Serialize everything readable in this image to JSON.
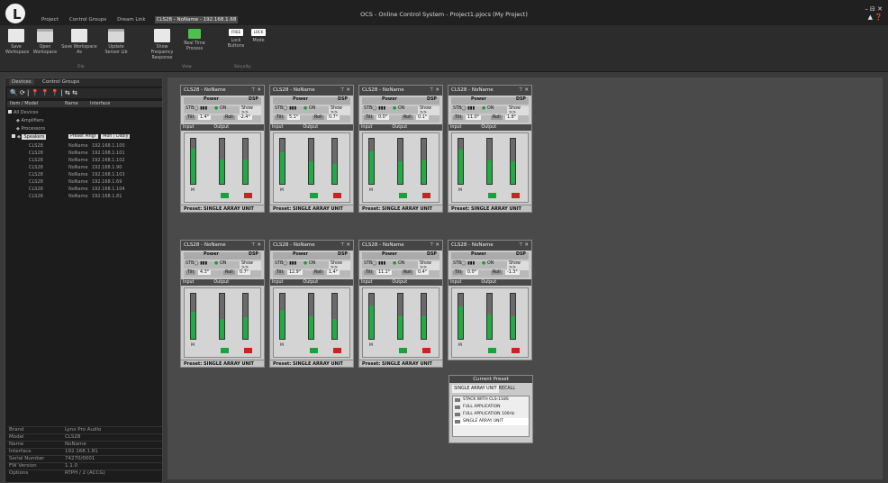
{
  "app": {
    "title": "OCS - Online Control System - Project1.pjocs (My Project)",
    "window_controls": "– ⊟ ✕",
    "help": "▲ ❓"
  },
  "menu_tabs": [
    "Project",
    "Control Groups",
    "Dream Link",
    "CLS28 - NoName - 192.168.1.68"
  ],
  "ribbon": {
    "buttons": [
      "Save Workspace",
      "Open Workspace",
      "Save Workspace As",
      "Update Sensor Lib",
      "Show Frequency Response",
      "Real Time Process",
      "Lock Buttons",
      "Mode"
    ],
    "groups": [
      "File",
      "View",
      "Security"
    ],
    "small_labels": [
      "FREE",
      "LOCK"
    ]
  },
  "left_panel": {
    "tabs": [
      "Devices",
      "Control Groups"
    ],
    "toolbar": "🔍 ⟳ | 📍 📍 📍 | ⇆ ⇆",
    "columns": [
      "Item / Model",
      "Name",
      "Interface"
    ],
    "tree": [
      "All Devices",
      "Amplifiers",
      "Processors",
      "Speakers"
    ],
    "preset_buttons": [
      "Preset Mngr",
      "Mon / Dsbly"
    ],
    "devices": [
      {
        "model": "CLS28",
        "name": "NoName",
        "ip": "192.168.1.100"
      },
      {
        "model": "CLS28",
        "name": "NoName",
        "ip": "192.168.1.101"
      },
      {
        "model": "CLS28",
        "name": "NoName",
        "ip": "192.168.1.102"
      },
      {
        "model": "CLS28",
        "name": "NoName",
        "ip": "192.168.1.90"
      },
      {
        "model": "CLS28",
        "name": "NoName",
        "ip": "192.168.1.103"
      },
      {
        "model": "CLS28",
        "name": "NoName",
        "ip": "192.168.1.69"
      },
      {
        "model": "CLS28",
        "name": "NoName",
        "ip": "192.168.1.104"
      },
      {
        "model": "CLS28",
        "name": "NoName",
        "ip": "192.168.1.81"
      }
    ],
    "properties": [
      {
        "key": "Brand",
        "value": "Lynx Pro Audio"
      },
      {
        "key": "Model",
        "value": "CLS28"
      },
      {
        "key": "Name",
        "value": "NoName"
      },
      {
        "key": "Interface",
        "value": "192.168.1.81"
      },
      {
        "key": "Serial Number",
        "value": "74270/0001"
      },
      {
        "key": "FW Version",
        "value": "1.1.0"
      },
      {
        "key": "Options",
        "value": "RTPH / 2 (ACCG)"
      }
    ]
  },
  "panels": [
    {
      "title": "CLS28 - NoName",
      "tilt": "1.4°",
      "roll": "-2.4°",
      "preset": "SINGLE ARRAY UNIT",
      "lvl": [
        0.78,
        0.55,
        0.55
      ]
    },
    {
      "title": "CLS28 - NoName",
      "tilt": "5.1°",
      "roll": "0.7°",
      "preset": "SINGLE ARRAY UNIT",
      "lvl": [
        0.7,
        0.5,
        0.45
      ]
    },
    {
      "title": "CLS28 - NoName",
      "tilt": "0.0°",
      "roll": "0.1°",
      "preset": "SINGLE ARRAY UNIT",
      "lvl": [
        0.72,
        0.5,
        0.52
      ]
    },
    {
      "title": "CLS28 - NoName",
      "tilt": "11.0°",
      "roll": "1.8°",
      "preset": "SINGLE ARRAY UNIT",
      "lvl": [
        0.76,
        0.52,
        0.5
      ]
    },
    {
      "title": "CLS28 - NoName",
      "tilt": "4.3°",
      "roll": "0.7°",
      "preset": "SINGLE ARRAY UNIT",
      "lvl": [
        0.6,
        0.45,
        0.48
      ]
    },
    {
      "title": "CLS28 - NoName",
      "tilt": "12.9°",
      "roll": "1.4°",
      "preset": "SINGLE ARRAY UNIT",
      "lvl": [
        0.64,
        0.5,
        0.45
      ]
    },
    {
      "title": "CLS28 - NoName",
      "tilt": "11.1°",
      "roll": "0.4°",
      "preset": "SINGLE ARRAY UNIT",
      "lvl": [
        0.74,
        0.5,
        0.5
      ]
    },
    {
      "title": "CLS28 - NoName",
      "tilt": "0.0°",
      "roll": "-1.3°",
      "preset": "",
      "lvl": [
        0.72,
        0.55,
        0.5
      ]
    }
  ],
  "labels": {
    "power": "Power",
    "dsp": "DSP",
    "on": "ON",
    "show": "Show >>",
    "tilt": "Tilt",
    "roll": "Roll",
    "input": "Input",
    "output": "Output",
    "preset": "Preset:",
    "mute": "M"
  },
  "current_preset": {
    "title": "Current Preset",
    "selected": "SINGLE ARRAY UNIT",
    "recall": "RECALL",
    "options": [
      "STACK WITH CLS-118S",
      "FULL APPLICATION",
      "FULL APPLICATION 100Hz",
      "SINGLE ARRAY UNIT"
    ]
  },
  "colors": {
    "meter": "#22aa44",
    "mute_green": "#1aa03e",
    "mute_red": "#cc2222",
    "bg": "#3a3a3a"
  }
}
